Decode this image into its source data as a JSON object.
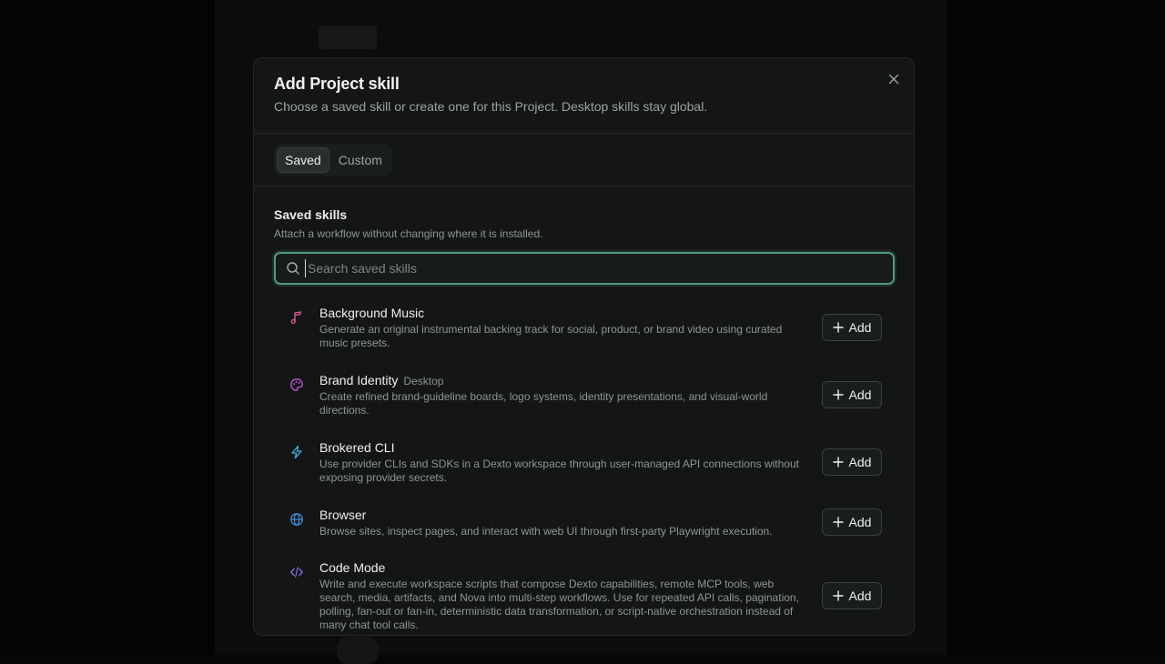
{
  "modal": {
    "title": "Add Project skill",
    "subtitle": "Choose a saved skill or create one for this Project. Desktop skills stay global.",
    "close_icon": "close-icon"
  },
  "tabs": [
    {
      "label": "Saved",
      "active": true
    },
    {
      "label": "Custom",
      "active": false
    }
  ],
  "section": {
    "title": "Saved skills",
    "description": "Attach a workflow without changing where it is installed."
  },
  "search": {
    "placeholder": "Search saved skills",
    "value": "",
    "icon": "search-icon"
  },
  "skills": [
    {
      "name": "Background Music",
      "badge": "",
      "description": "Generate an original instrumental backing track for social, product, or brand video using curated music presets.",
      "icon": "music-note-icon",
      "icon_color": "#e0609a",
      "add_label": "Add"
    },
    {
      "name": "Brand Identity",
      "badge": "Desktop",
      "description": "Create refined brand-guideline boards, logo systems, identity presentations, and visual-world directions.",
      "icon": "palette-icon",
      "icon_color": "#c45bd6",
      "add_label": "Add"
    },
    {
      "name": "Brokered CLI",
      "badge": "",
      "description": "Use provider CLIs and SDKs in a Dexto workspace through user-managed API connections without exposing provider secrets.",
      "icon": "lightning-icon",
      "icon_color": "#3fb6e0",
      "add_label": "Add"
    },
    {
      "name": "Browser",
      "badge": "",
      "description": "Browse sites, inspect pages, and interact with web UI through first-party Playwright execution.",
      "icon": "globe-icon",
      "icon_color": "#3f8fe0",
      "add_label": "Add"
    },
    {
      "name": "Code Mode",
      "badge": "",
      "description": "Write and execute workspace scripts that compose Dexto capabilities, remote MCP tools, web search, media, artifacts, and Nova into multi-step workflows. Use for repeated API calls, pagination, polling, fan-out or fan-in, deterministic data transformation, or script-native orchestration instead of many chat tool calls.",
      "icon": "code-icon",
      "icon_color": "#8a6ee0",
      "add_label": "Add"
    }
  ]
}
